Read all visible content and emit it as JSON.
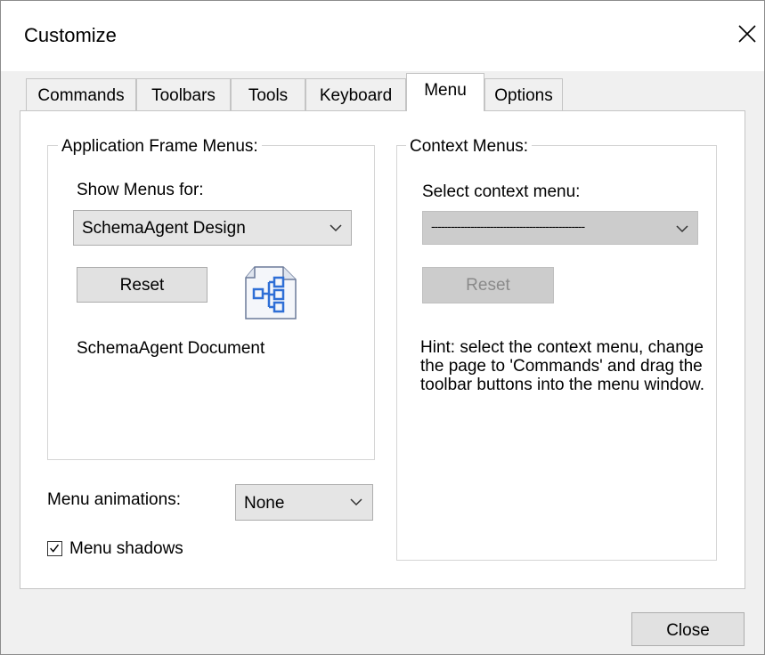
{
  "window": {
    "title": "Customize"
  },
  "tabs": [
    {
      "label": "Commands"
    },
    {
      "label": "Toolbars"
    },
    {
      "label": "Tools"
    },
    {
      "label": "Keyboard"
    },
    {
      "label": "Menu"
    },
    {
      "label": "Options"
    }
  ],
  "active_tab": "Menu",
  "app_frame": {
    "group_title": "Application Frame Menus:",
    "show_menus_label": "Show Menus for:",
    "show_menus_value": "SchemaAgent Design",
    "reset_label": "Reset",
    "document_label": "SchemaAgent Document",
    "icon": "schema-document-icon"
  },
  "context": {
    "group_title": "Context Menus:",
    "select_label": "Select context menu:",
    "select_value": "-----------------------------------------------",
    "reset_label": "Reset",
    "hint": "Hint: select the context menu, change the page to 'Commands' and drag the toolbar buttons into the menu window."
  },
  "animations": {
    "label": "Menu animations:",
    "value": "None"
  },
  "shadows": {
    "label": "Menu shadows",
    "checked": true
  },
  "footer": {
    "close_label": "Close"
  },
  "colors": {
    "accent": "#0078d7",
    "icon_blue": "#2f6fd6"
  }
}
